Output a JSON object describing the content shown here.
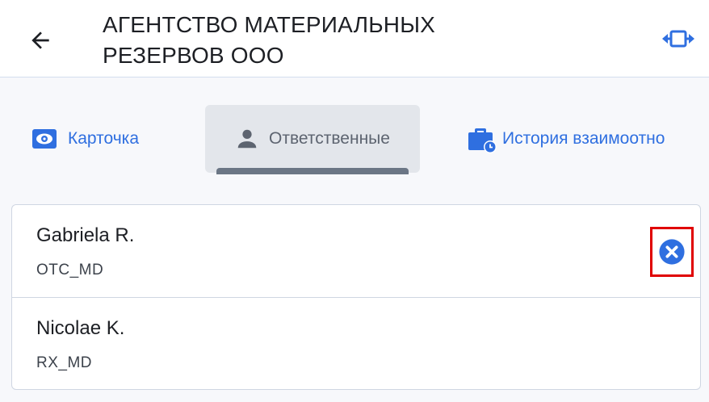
{
  "header": {
    "title_line1": "АГЕНТСТВО МАТЕРИАЛЬНЫХ",
    "title_line2": "РЕЗЕРВОВ ООО",
    "back_icon": "arrow-left-icon",
    "expand_icon": "expand-horizontal-icon"
  },
  "tabs": [
    {
      "label": "Карточка",
      "icon": "eye-card-icon",
      "active": false
    },
    {
      "label": "Ответственные",
      "icon": "person-icon",
      "active": true
    },
    {
      "label": "История взаимоотно",
      "icon": "briefcase-clock-icon",
      "active": false
    }
  ],
  "responsibles": [
    {
      "name": "Gabriela R.",
      "code": "OTC_MD",
      "remove_icon": "close-circle-icon"
    },
    {
      "name": "Nicolae K.",
      "code": "RX_MD"
    }
  ],
  "colors": {
    "accent": "#2f6fe0",
    "highlight_box": "#e00000",
    "active_tab_bg": "#e3e6eb"
  }
}
